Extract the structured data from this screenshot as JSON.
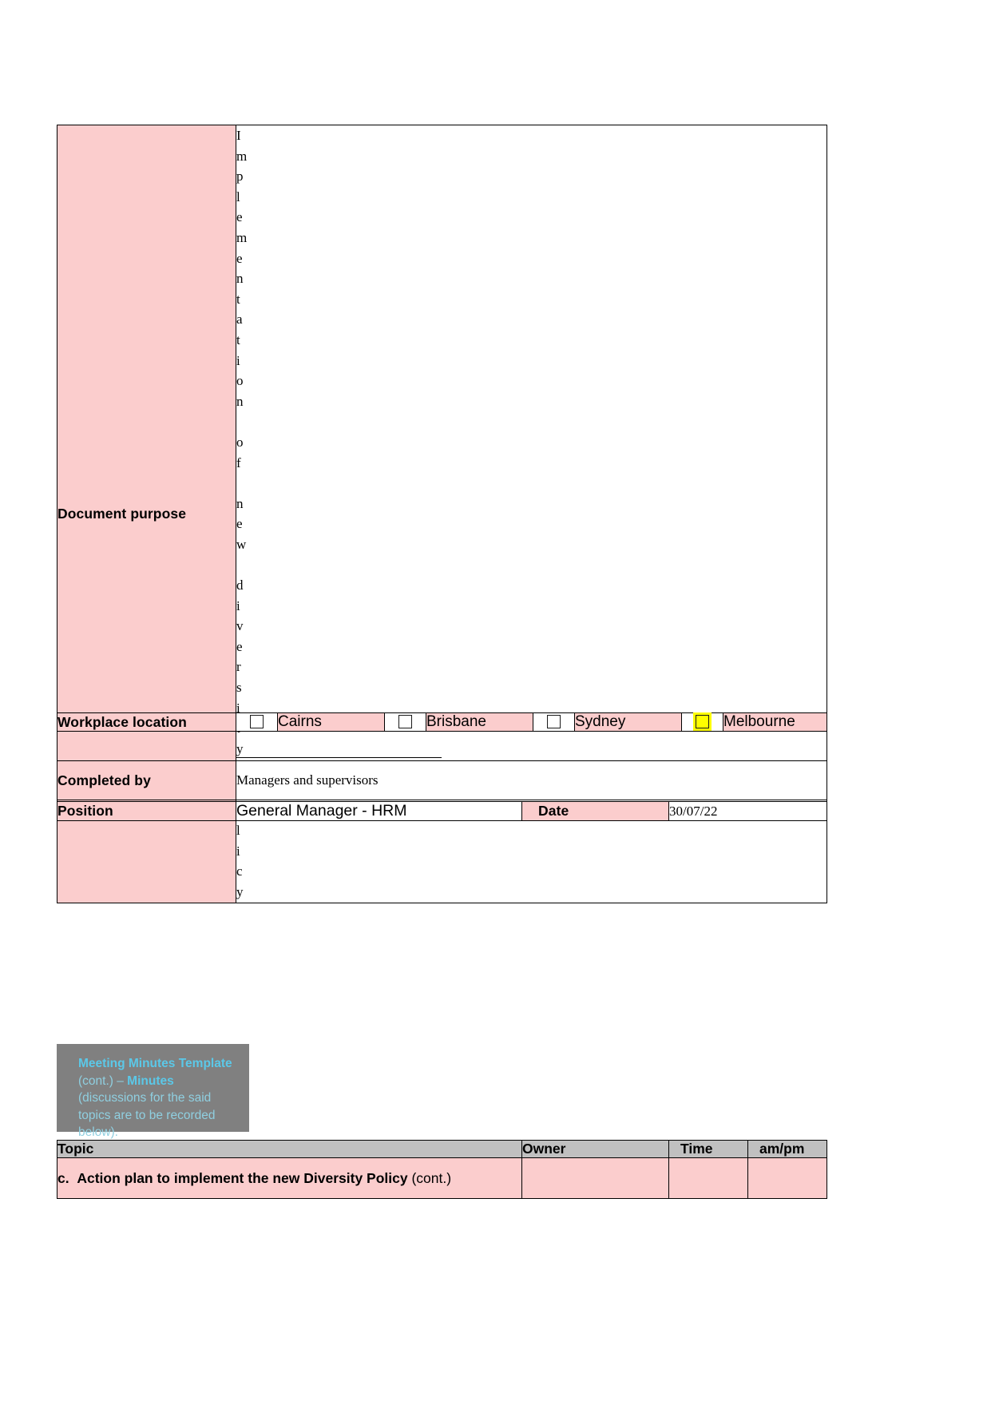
{
  "form": {
    "rows": {
      "document_purpose": {
        "label": "Document purpose",
        "value": "Implementation of new diversity policy"
      },
      "workplace_location": {
        "label": "Workplace location",
        "options": [
          {
            "name": "Cairns",
            "checked": false
          },
          {
            "name": "Brisbane",
            "checked": false
          },
          {
            "name": "Sydney",
            "checked": false
          },
          {
            "name": "Melbourne",
            "checked": true
          }
        ]
      },
      "completed_by": {
        "label": "Completed by",
        "value": "Managers and supervisors"
      },
      "position": {
        "label": "Position",
        "value": "General Manager - HRM"
      },
      "date": {
        "label": "Date",
        "value": "30/07/22"
      }
    }
  },
  "callout": {
    "title_bold_1": "Meeting Minutes Template",
    "mid_1": " (cont.) – ",
    "title_bold_2": "Minutes",
    "mid_2": " (discussions for the said topics are to be recorded below)."
  },
  "minutes": {
    "headers": [
      "Topic",
      "Owner",
      "Time",
      "am/pm"
    ],
    "rows": [
      {
        "marker": "c.",
        "topic_bold": "Action plan to implement the new Diversity Policy",
        "topic_suffix": " (cont.)",
        "owner": "",
        "time": "",
        "ampm": ""
      }
    ]
  },
  "colors": {
    "pink": "#fbcdcd",
    "gray_box": "#808080",
    "gray_header": "#c0c0c0",
    "highlight": "#ffff00",
    "callout_text": "#8fcfe0"
  }
}
